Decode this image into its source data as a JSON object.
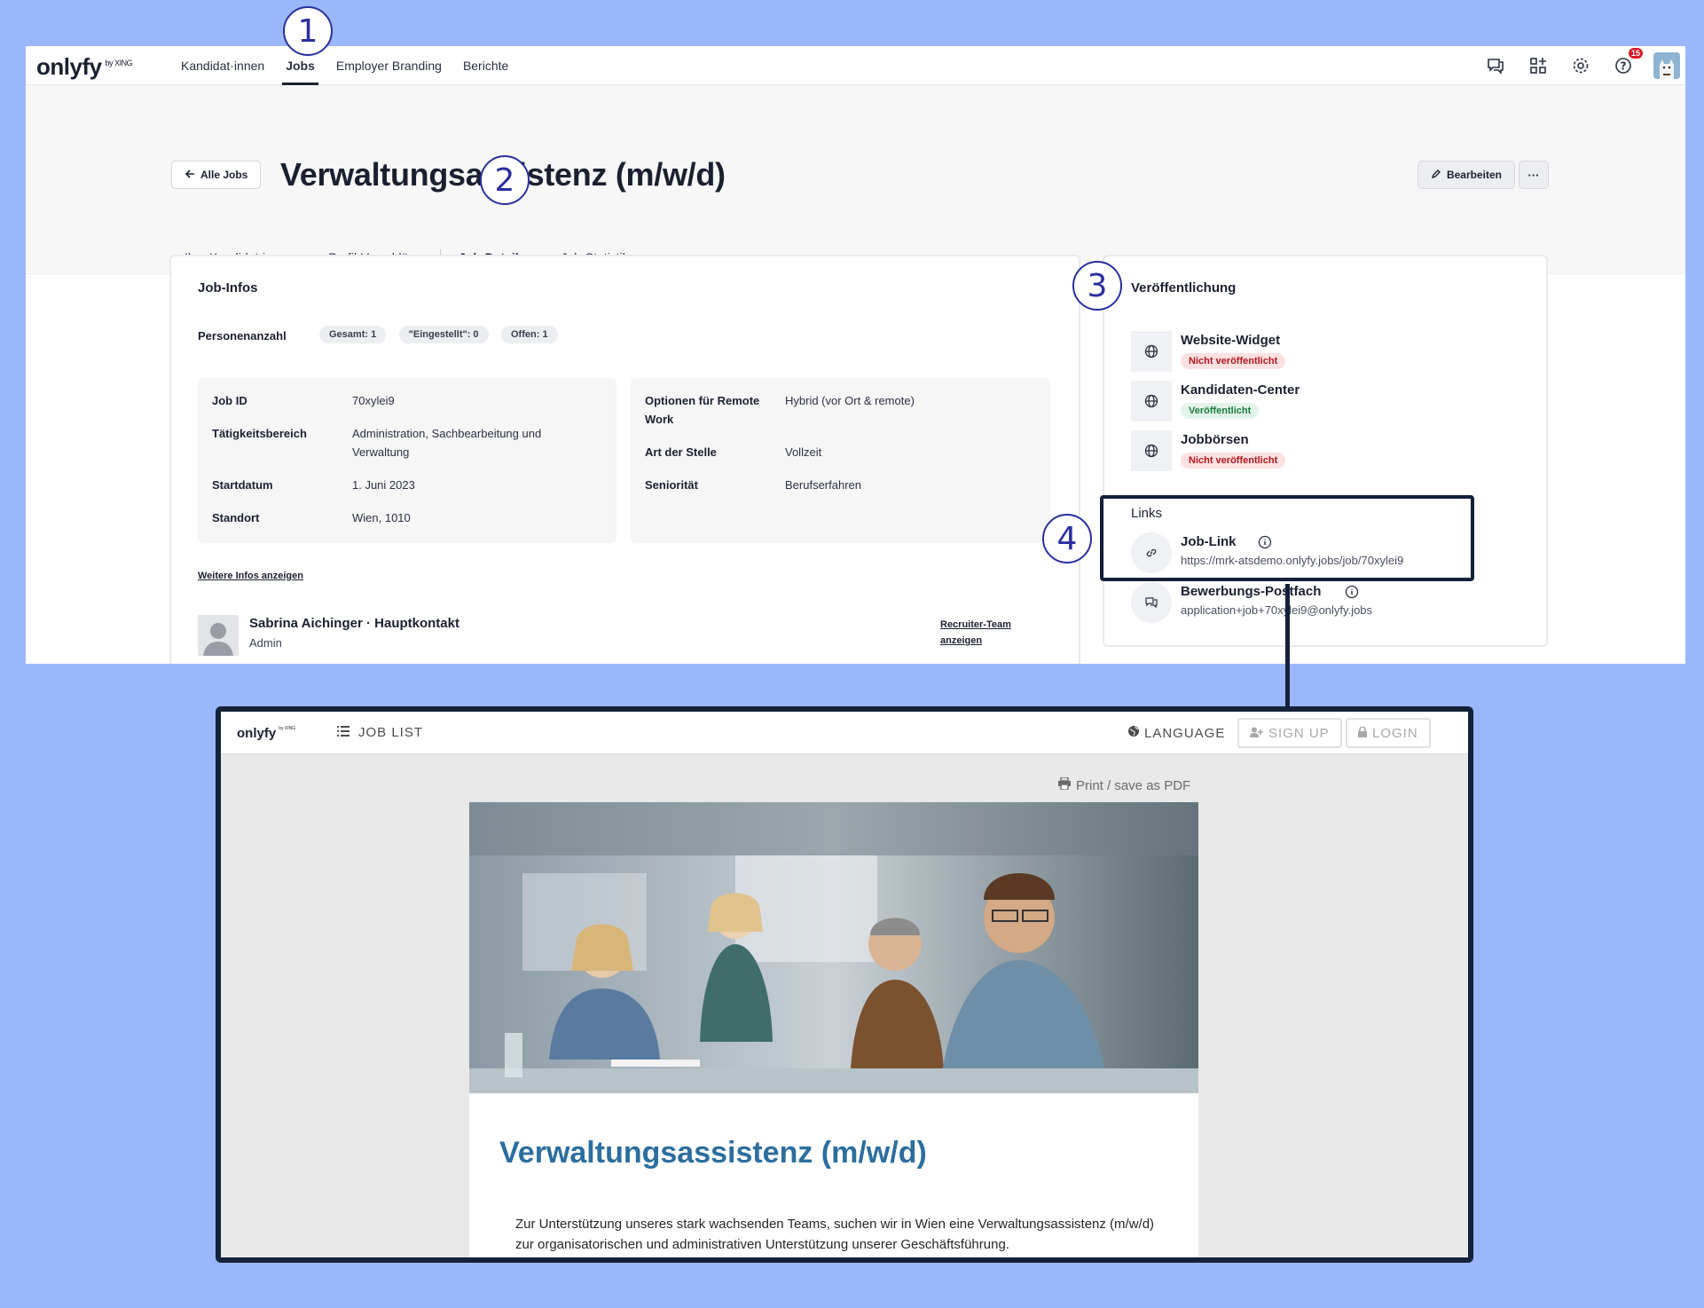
{
  "app": {
    "logo": "onlyfy",
    "logo_suffix": "by XING",
    "nav": [
      "Kandidat·innen",
      "Jobs",
      "Employer Branding",
      "Berichte"
    ],
    "notification_count": "15",
    "icons": [
      "chat-icon",
      "widgets-icon",
      "gear-icon",
      "help-icon",
      "avatar"
    ]
  },
  "header": {
    "back_label": "Alle Jobs",
    "title": "Verwaltungsassistenz (m/w/d)",
    "edit_label": "Bearbeiten",
    "more_label": "···",
    "tabs": [
      "Ihre Kandidat·innen",
      "Profil-Vorschläge",
      "Job-Details",
      "Job-Statistik"
    ]
  },
  "job_infos": {
    "heading": "Job-Infos",
    "personen_label": "Personenanzahl",
    "pills": [
      "Gesamt: 1",
      "\"Eingestellt\": 0",
      "Offen: 1"
    ],
    "left_rows": [
      {
        "k": "Job ID",
        "v": "70xylei9"
      },
      {
        "k": "Tätigkeitsbereich",
        "v": "Administration, Sachbearbeitung und Verwaltung"
      },
      {
        "k": "Startdatum",
        "v": "1. Juni 2023"
      },
      {
        "k": "Standort",
        "v": "Wien, 1010"
      }
    ],
    "right_rows": [
      {
        "k": "Optionen für Remote Work",
        "v": "Hybrid (vor Ort & remote)"
      },
      {
        "k": "Art der Stelle",
        "v": "Vollzeit"
      },
      {
        "k": "Seniorität",
        "v": "Berufserfahren"
      }
    ],
    "more_link": "Weitere Infos anzeigen",
    "contact_name": "Sabrina Aichinger · Hauptkontakt",
    "contact_role": "Admin",
    "team_link": "Recruiter-Team anzeigen"
  },
  "publication": {
    "heading": "Veröffentlichung",
    "items": [
      {
        "label": "Website-Widget",
        "status": "Nicht veröffentlicht"
      },
      {
        "label": "Kandidaten-Center",
        "status": "Veröffentlicht"
      },
      {
        "label": "Jobbörsen",
        "status": "Nicht veröffentlicht"
      }
    ],
    "links_heading": "Links",
    "links": [
      {
        "label": "Job-Link",
        "value": "https://mrk-atsdemo.onlyfy.jobs/job/70xylei9"
      },
      {
        "label": "Bewerbungs-Postfach",
        "value": "application+job+70xylei9@onlyfy.jobs"
      }
    ]
  },
  "callouts": [
    "1",
    "2",
    "3",
    "4"
  ],
  "jobpage": {
    "logo": "onlyfy",
    "logo_suffix": "by XING",
    "job_list": "JOB LIST",
    "language": "LANGUAGE",
    "sign_up": "SIGN UP",
    "login": "LOGIN",
    "print": "Print / save as PDF",
    "title": "Verwaltungsassistenz (m/w/d)",
    "intro": "Zur Unterstützung unseres stark wachsenden Teams, suchen wir in Wien eine Verwaltungsassistenz (m/w/d) zur organisatorischen und administrativen Unterstützung unserer Geschäftsführung."
  },
  "colors": {
    "background": "#9bb7fb",
    "callout": "#2a2fa0",
    "frame": "#14213b",
    "job_title_blue": "#2c6e9f",
    "status_red": "#b5171e",
    "status_green": "#1e7a3c"
  }
}
